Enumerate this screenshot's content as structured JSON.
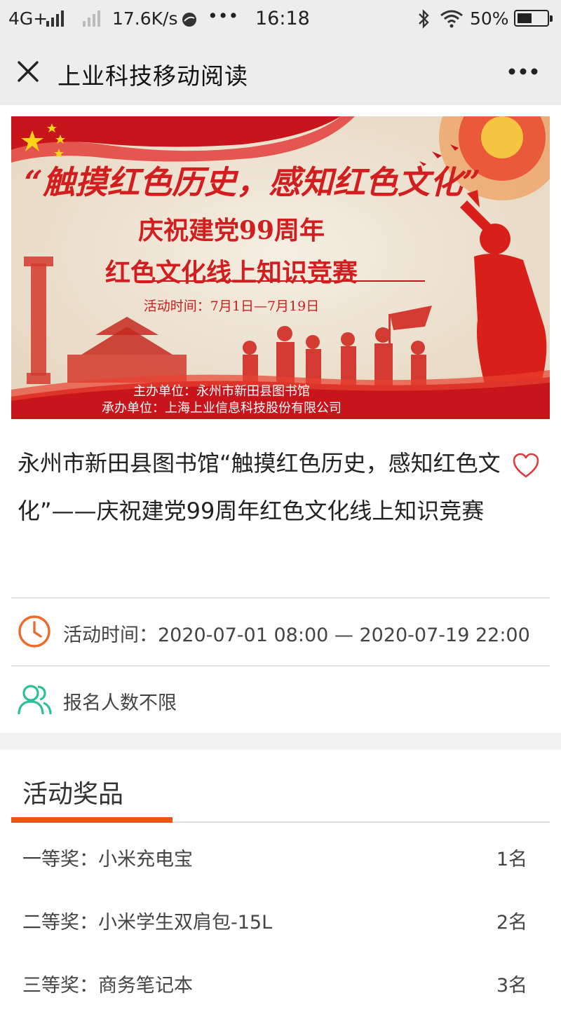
{
  "status_bar": {
    "network": "4G+",
    "speed": "17.6K/s",
    "more": "•••",
    "time": "16:18",
    "battery": "50%"
  },
  "nav": {
    "title": "上业科技移动阅读",
    "icons": [
      "close-icon",
      "more-icon"
    ]
  },
  "banner": {
    "slogan": "“触摸红色历史，感知红色文化”",
    "line1": "庆祝建党99周年",
    "line2": "红色文化线上知识竞赛",
    "time": "活动时间：7月1日—7月19日",
    "host": "主办单位：永州市新田县图书馆",
    "organizer": "承办单位：上海上业信息科技股份有限公司"
  },
  "activity": {
    "title": "永州市新田县图书馆“触摸红色历史，感知红色文化”——庆祝建党99周年红色文化线上知识竞赛",
    "time": "活动时间：2020-07-01 08:00 — 2020-07-19 22:00",
    "signup": "报名人数不限"
  },
  "prizes": {
    "heading": "活动奖品",
    "items": [
      {
        "name": "一等奖：小米充电宝",
        "count": "1名"
      },
      {
        "name": "二等奖：小米学生双肩包-15L",
        "count": "2名"
      },
      {
        "name": "三等奖：商务笔记本",
        "count": "3名"
      }
    ]
  },
  "colors": {
    "accent": "#ee5218",
    "heart": "#e03a3a",
    "clock": "#ee6a2a",
    "people": "#2bbf9a"
  }
}
